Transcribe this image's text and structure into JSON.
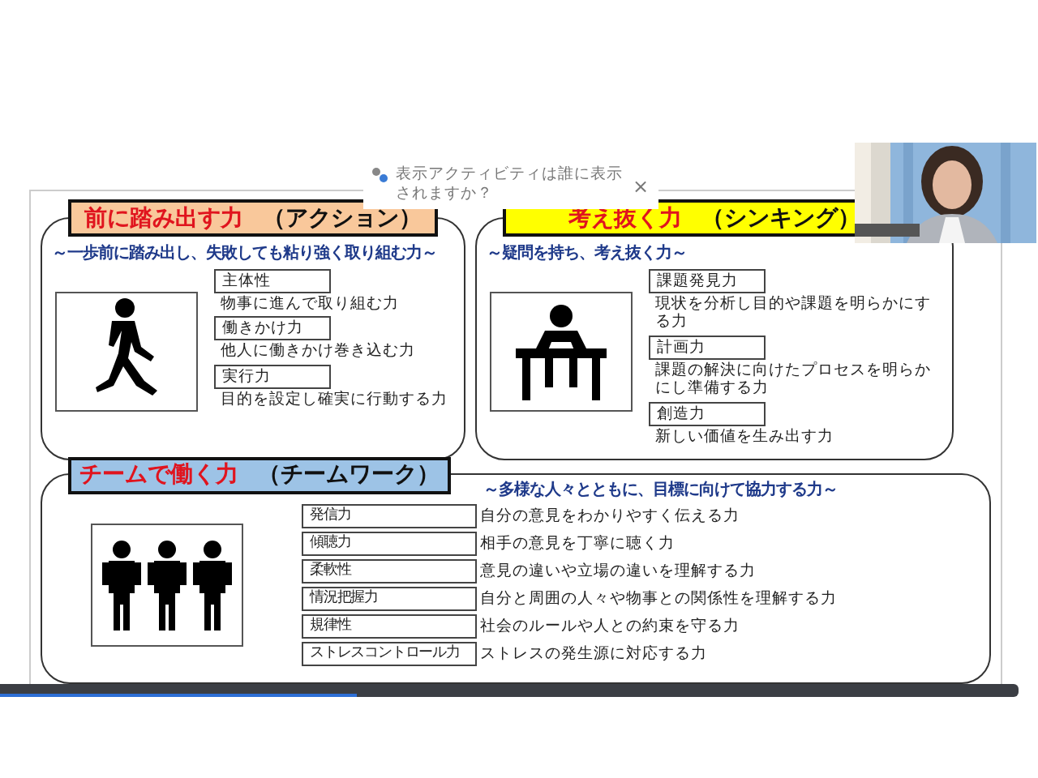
{
  "popup": {
    "text": "表示アクティビティは誰に表示されますか？",
    "close": "×"
  },
  "top_panels": [
    {
      "title_main": "前に踏み出す力",
      "title_sub": "（アクション）",
      "color": "#f9c89b",
      "subtitle": "～一歩前に踏み出し、失敗しても粘り強く取り組む力～",
      "figure": {
        "kind": "walker"
      },
      "items": [
        {
          "name": "主体性",
          "desc": "物事に進んで取り組む力"
        },
        {
          "name": "働きかけ力",
          "desc": "他人に働きかけ巻き込む力"
        },
        {
          "name": "実行力",
          "desc": "目的を設定し確実に行動する力"
        }
      ]
    },
    {
      "title_main": "考え抜く力",
      "title_sub": "（シンキング）",
      "color": "#ffff00",
      "subtitle": "～疑問を持ち、考え抜く力～",
      "figure": {
        "kind": "desk"
      },
      "items": [
        {
          "name": "課題発見力",
          "desc": "現状を分析し目的や課題を明らかにする力"
        },
        {
          "name": "計画力",
          "desc": "課題の解決に向けたプロセスを明らかにし準備する力"
        },
        {
          "name": "創造力",
          "desc": "新しい価値を生み出す力"
        }
      ]
    }
  ],
  "team_panel": {
    "title_main": "チームで働く力",
    "title_sub": "（チームワーク）",
    "color": "#9dc3e6",
    "subtitle": "～多様な人々とともに、目標に向けて協力する力～",
    "figure": {
      "kind": "group"
    },
    "rows": [
      {
        "name": "発信力",
        "desc": "自分の意見をわかりやすく伝える力"
      },
      {
        "name": "傾聴力",
        "desc": "相手の意見を丁寧に聴く力"
      },
      {
        "name": "柔軟性",
        "desc": "意見の違いや立場の違いを理解する力"
      },
      {
        "name": "情況把握力",
        "desc": "自分と周囲の人々や物事との関係性を理解する力"
      },
      {
        "name": "規律性",
        "desc": "社会のルールや人との約束を守る力"
      },
      {
        "name": "ストレスコントロール力",
        "desc": "ストレスの発生源に対応する力"
      }
    ]
  },
  "progress": {
    "level": 0.35
  }
}
